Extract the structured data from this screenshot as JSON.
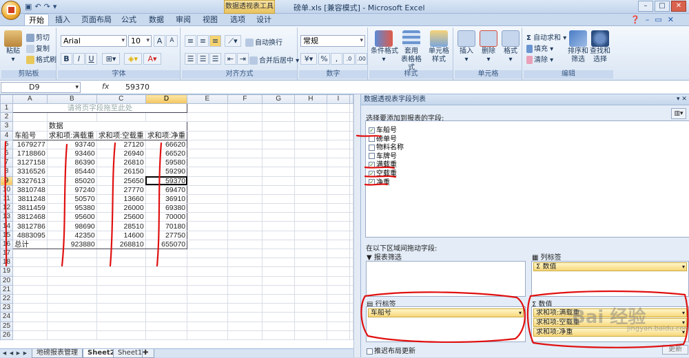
{
  "window": {
    "title": "磅单.xls  [兼容模式] - Microsoft Excel",
    "context_tools": "数据透视表工具"
  },
  "tabs": [
    "开始",
    "插入",
    "页面布局",
    "公式",
    "数据",
    "审阅",
    "视图",
    "选项",
    "设计"
  ],
  "ribbon": {
    "clipboard": {
      "label": "剪贴板",
      "paste": "粘贴",
      "cut": "剪切",
      "copy": "复制",
      "format_painter": "格式刷"
    },
    "font": {
      "label": "字体",
      "name": "Arial",
      "size": "10",
      "bold": "B",
      "italic": "I",
      "underline": "U"
    },
    "alignment": {
      "label": "对齐方式",
      "wrap": "自动换行",
      "merge": "合并后居中"
    },
    "number": {
      "label": "数字",
      "format": "常规",
      "percent": "%",
      "comma": ","
    },
    "styles": {
      "label": "样式",
      "conditional": "条件格式",
      "table_format": "套用\n表格格式",
      "cell_styles": "单元格\n样式"
    },
    "cells": {
      "label": "单元格",
      "insert": "插入",
      "delete": "删除",
      "format": "格式"
    },
    "editing": {
      "label": "编辑",
      "autosum": "自动求和",
      "fill": "填充",
      "clear": "清除",
      "sort_filter": "排序和\n筛选",
      "find_select": "查找和\n选择"
    }
  },
  "formula_bar": {
    "name_box": "D9",
    "fx": "fx",
    "content": "59370"
  },
  "sheet": {
    "columns": [
      "A",
      "B",
      "C",
      "D",
      "E",
      "F",
      "G",
      "H",
      "I"
    ],
    "row1_placeholder": "请将页字段拖至此处",
    "data_header": "数据",
    "headers": [
      "车船号",
      "求和项:满载重",
      "求和项:空载重",
      "求和项:净重"
    ],
    "rows": [
      [
        "1679277",
        "93740",
        "27120",
        "66620"
      ],
      [
        "1718860",
        "93460",
        "26940",
        "66520"
      ],
      [
        "3127158",
        "86390",
        "26810",
        "59580"
      ],
      [
        "3316526",
        "85440",
        "26150",
        "59290"
      ],
      [
        "3327613",
        "85020",
        "25650",
        "59370"
      ],
      [
        "3810748",
        "97240",
        "27770",
        "69470"
      ],
      [
        "3811248",
        "50570",
        "13660",
        "36910"
      ],
      [
        "3811459",
        "95380",
        "26000",
        "69380"
      ],
      [
        "3812468",
        "95600",
        "25600",
        "70000"
      ],
      [
        "3812786",
        "98690",
        "28510",
        "70180"
      ],
      [
        "4883095",
        "42350",
        "14600",
        "27750"
      ]
    ],
    "total": [
      "总计",
      "923880",
      "268810",
      "655070"
    ],
    "tabs": [
      "地磅报表管理",
      "Sheet2",
      "Sheet1"
    ]
  },
  "pivot": {
    "title": "数据透视表字段列表",
    "choose_label": "选择要添加到报表的字段:",
    "fields": [
      {
        "name": "车船号",
        "checked": true
      },
      {
        "name": "磅单号",
        "checked": false
      },
      {
        "name": "物料名称",
        "checked": false
      },
      {
        "name": "车牌号",
        "checked": false
      },
      {
        "name": "满载重",
        "checked": true
      },
      {
        "name": "空载重",
        "checked": true
      },
      {
        "name": "净重",
        "checked": true
      }
    ],
    "drag_label": "在以下区域间拖动字段:",
    "report_filter": "报表筛选",
    "column_labels": "列标签",
    "column_item": "Σ 数值",
    "row_labels": "行标签",
    "row_item": "车船号",
    "values": "数值",
    "value_items": [
      "求和项:满载重",
      "求和项:空载重",
      "求和项:净重"
    ],
    "defer": "推迟布局更新",
    "update": "更新"
  },
  "watermark": {
    "main": "Bai 经验",
    "sub": "jingyan.baidu.com"
  }
}
